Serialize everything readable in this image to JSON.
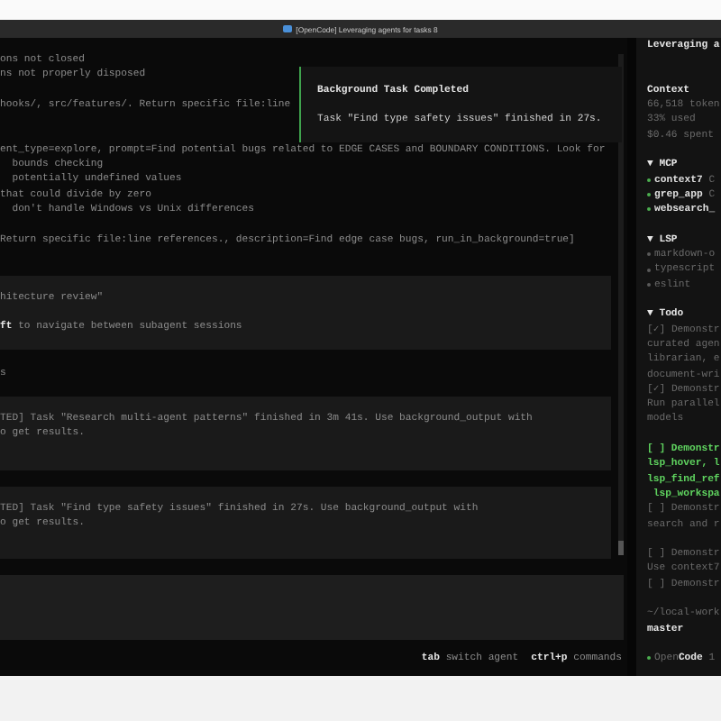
{
  "window": {
    "title": "[OpenCode] Leveraging agents for tasks 8"
  },
  "log": [
    {
      "kind": "output",
      "groups": [
        [
          "ons not closed",
          "ns not properly disposed"
        ],
        [
          "hooks/, src/features/. Return specific file:line"
        ],
        [
          "ent_type=explore, prompt=Find potential bugs related to EDGE CASES and BOUNDARY CONDITIONS. Look for",
          "  bounds checking",
          "  potentially undefined values",
          "that could divide by zero",
          "  don't handle Windows vs Unix differences"
        ],
        [
          "Return specific file:line references., description=Find edge case bugs, run_in_background=true]"
        ]
      ]
    },
    {
      "kind": "panel",
      "groups": [
        [
          "hitecture review\""
        ],
        [
          "**ft** to navigate between subagent sessions"
        ]
      ]
    },
    {
      "kind": "output",
      "groups": [
        [
          "s"
        ]
      ]
    },
    {
      "kind": "notice",
      "groups": [
        [
          "TED] Task \"Research multi-agent patterns\" finished in 3m 41s. Use background_output with",
          "o get results."
        ]
      ]
    },
    {
      "kind": "notice",
      "groups": [
        [
          "TED] Task \"Find type safety issues\" finished in 27s. Use background_output with",
          "o get results."
        ]
      ]
    }
  ],
  "toast": {
    "title": "Background Task Completed",
    "message": "Task \"Find type safety issues\" finished in 27s."
  },
  "hints": [
    {
      "key": "tab",
      "label": "switch agent"
    },
    {
      "key": "ctrl+p",
      "label": "commands"
    }
  ],
  "sidebar": {
    "title": "Leveraging a",
    "context": {
      "heading": "Context",
      "lines": [
        "66,518 token",
        "33% used",
        "$0.46 spent"
      ]
    },
    "sections": [
      {
        "toggle": "▼",
        "heading": "MCP",
        "items": [
          {
            "name": "context7",
            "status": "C",
            "color": "#4caf50",
            "active": true
          },
          {
            "name": "grep_app",
            "status": "C",
            "color": "#4caf50",
            "active": true
          },
          {
            "name": "websearch_",
            "color": "#4caf50",
            "active": true
          }
        ]
      },
      {
        "toggle": "▼",
        "heading": "LSP",
        "items": [
          {
            "name": "markdown-o",
            "color": "#5a5a5a",
            "active": false
          },
          {
            "name": "typescript",
            "color": "#5a5a5a",
            "active": false
          },
          {
            "name": "eslint",
            "color": "#5a5a5a",
            "active": false
          }
        ]
      }
    ],
    "todo": {
      "toggle": "▼",
      "heading": "Todo",
      "items": [
        {
          "active": false,
          "lines": [
            "[✓] Demonstr",
            "curated agen",
            "librarian, e",
            "document-wri"
          ]
        },
        {
          "active": false,
          "lines": [
            "[✓] Demonstr",
            "Run parallel",
            "models"
          ]
        },
        {
          "active": true,
          "lines": [
            "[ ] Demonstr",
            "lsp_hover, l",
            "lsp_find_ref",
            " lsp_workspa"
          ]
        },
        {
          "active": false,
          "lines": [
            "[ ] Demonstr",
            "search and r"
          ]
        },
        {
          "active": false,
          "lines": [
            "[ ] Demonstr",
            "Use context7"
          ]
        },
        {
          "active": false,
          "lines": [
            "[ ] Demonstr"
          ]
        }
      ]
    },
    "workspace": {
      "path": "~/local-work",
      "branch": "master"
    },
    "footer": {
      "text": "Open**Code** 1",
      "color": "#4caf50"
    }
  }
}
